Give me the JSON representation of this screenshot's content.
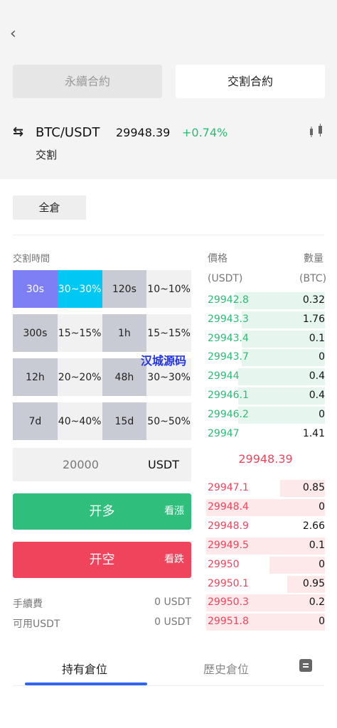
{
  "header": {
    "tabs": [
      {
        "label": "永續合約",
        "active": false
      },
      {
        "label": "交割合約",
        "active": true
      }
    ],
    "pair": "BTC/USDT",
    "price": "29948.39",
    "change": "+0.74%",
    "subtitle": "交割",
    "colors": {
      "up": "#2dbb74",
      "down": "#f0445c",
      "accent": "#3366ee"
    }
  },
  "margin_mode": "全倉",
  "trade": {
    "time_label": "交割時間",
    "options": [
      [
        {
          "time": "30s",
          "range": "30~30%",
          "selected": true
        },
        {
          "time": "120s",
          "range": "10~10%",
          "selected": false
        }
      ],
      [
        {
          "time": "300s",
          "range": "15~15%",
          "selected": false
        },
        {
          "time": "1h",
          "range": "15~15%",
          "selected": false
        }
      ],
      [
        {
          "time": "12h",
          "range": "20~20%",
          "selected": false
        },
        {
          "time": "48h",
          "range": "30~30%",
          "selected": false
        }
      ],
      [
        {
          "time": "7d",
          "range": "40~40%",
          "selected": false
        },
        {
          "time": "15d",
          "range": "50~50%",
          "selected": false
        }
      ]
    ],
    "amount": "20000",
    "amount_unit": "USDT",
    "long_label": "开多",
    "long_side": "看漲",
    "short_label": "开空",
    "short_side": "看跌",
    "fee_label": "手續費",
    "fee_value": "0 USDT",
    "available_label": "可用USDT",
    "available_value": "0 USDT"
  },
  "orderbook": {
    "price_label": "價格",
    "qty_label": "數量",
    "price_unit": "(USDT)",
    "qty_unit": "(BTC)",
    "buys": [
      {
        "price": "29942.8",
        "qty": "0.32",
        "depth": 0.76
      },
      {
        "price": "29943.3",
        "qty": "1.76",
        "depth": 0.7
      },
      {
        "price": "29943.4",
        "qty": "0.1",
        "depth": 0.7
      },
      {
        "price": "29943.7",
        "qty": "0",
        "depth": 0.7
      },
      {
        "price": "29944",
        "qty": "0.4",
        "depth": 0.73
      },
      {
        "price": "29946.1",
        "qty": "0.4",
        "depth": 0.73
      },
      {
        "price": "29946.2",
        "qty": "0",
        "depth": 0.73
      },
      {
        "price": "29947",
        "qty": "1.41",
        "depth": 0
      }
    ],
    "mid_price": "29948.39",
    "sells": [
      {
        "price": "29947.1",
        "qty": "0.85",
        "depth": 0.38
      },
      {
        "price": "29948.4",
        "qty": "0",
        "depth": 1.0
      },
      {
        "price": "29948.9",
        "qty": "2.66",
        "depth": 0
      },
      {
        "price": "29949.5",
        "qty": "0.1",
        "depth": 1.0
      },
      {
        "price": "29950",
        "qty": "0",
        "depth": 0.47
      },
      {
        "price": "29950.1",
        "qty": "0.95",
        "depth": 0.32
      },
      {
        "price": "29950.3",
        "qty": "0.2",
        "depth": 1.0
      },
      {
        "price": "29951.8",
        "qty": "0",
        "depth": 1.0
      }
    ]
  },
  "watermark": "汉城源码",
  "positions": {
    "tab_holding": "持有倉位",
    "tab_history": "歷史倉位"
  }
}
